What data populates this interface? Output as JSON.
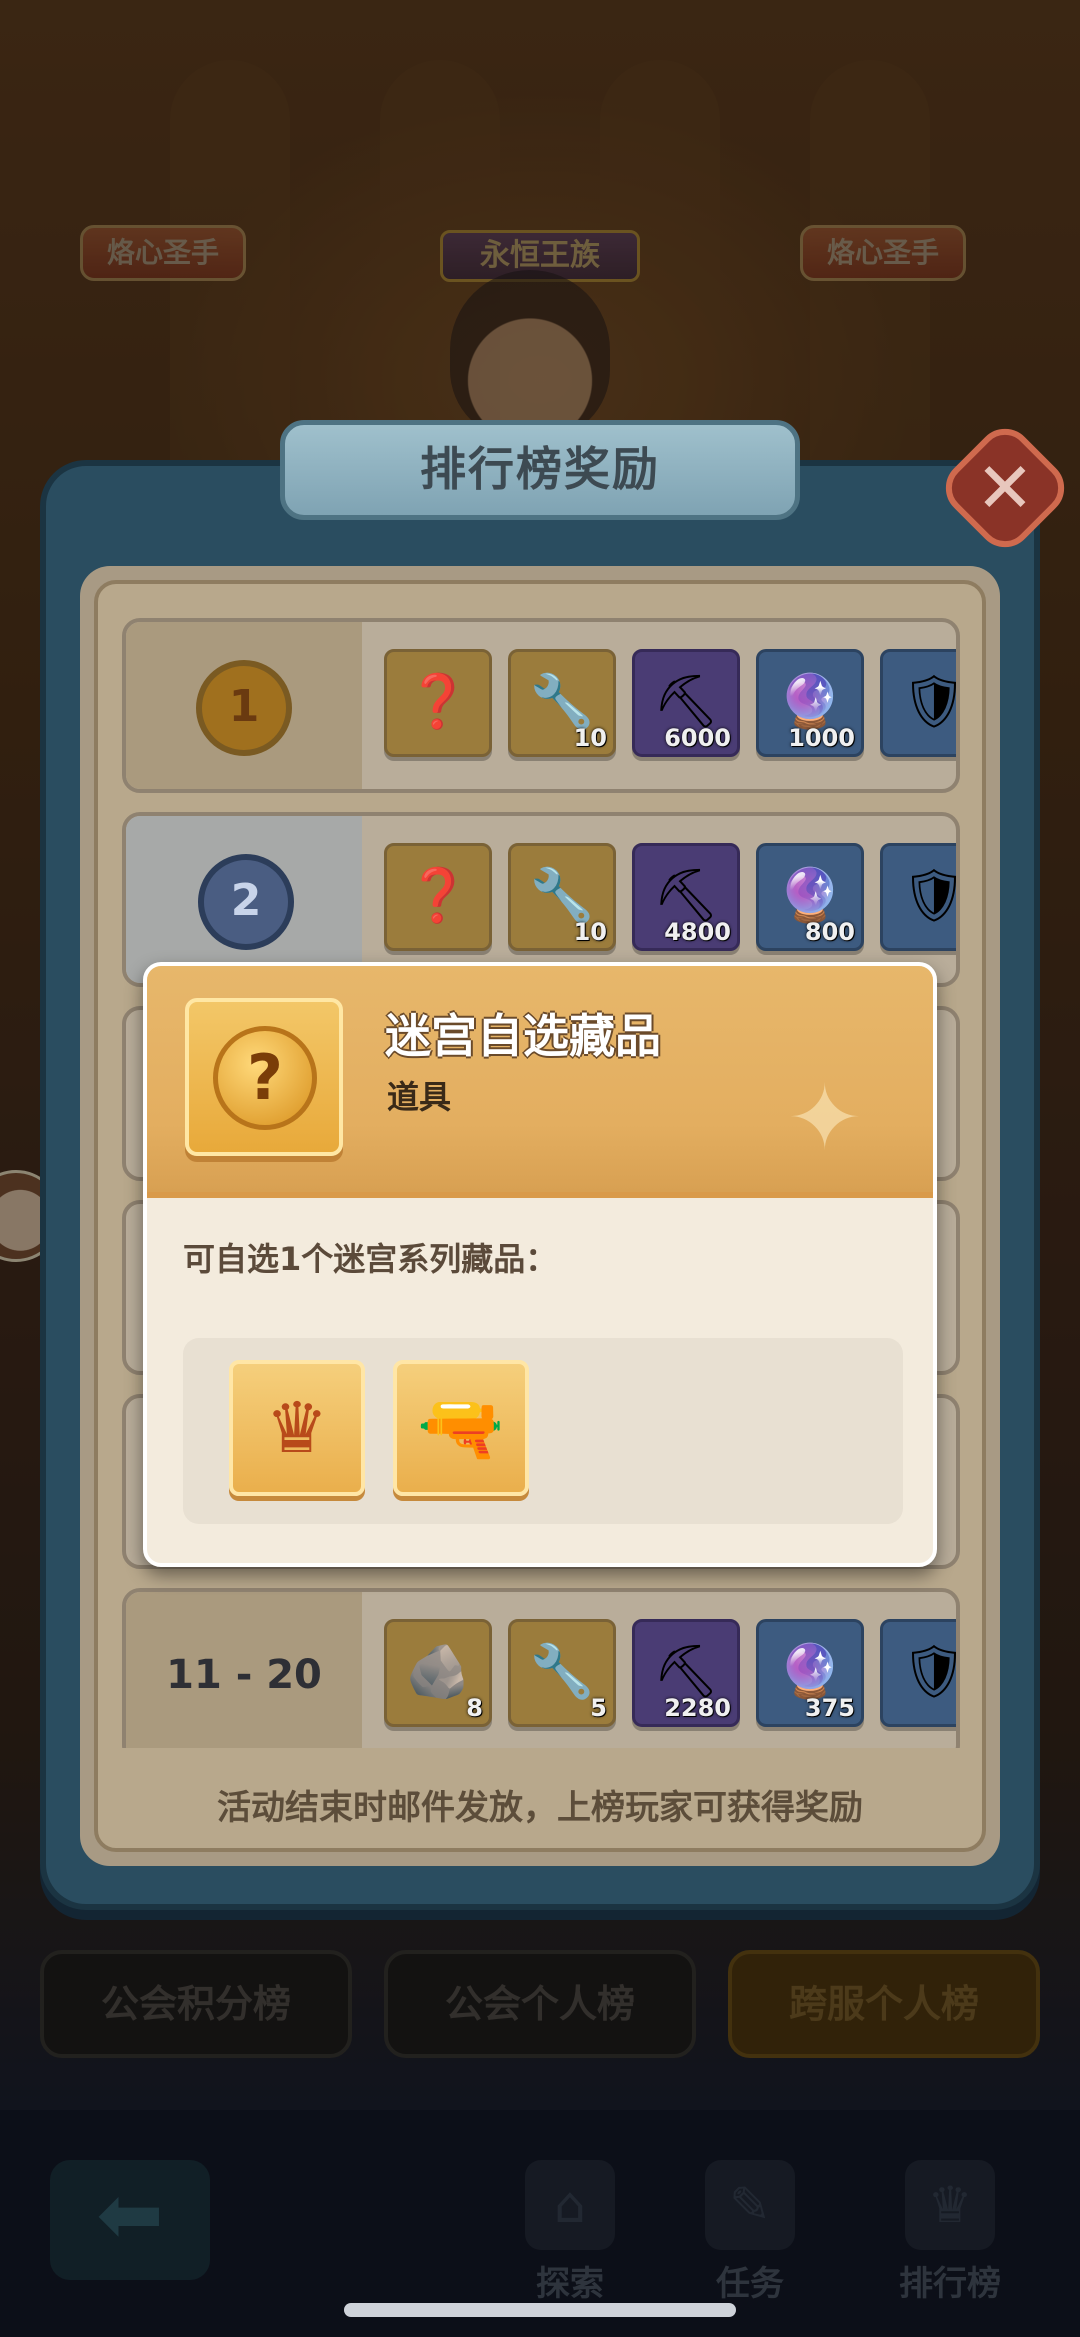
{
  "background": {
    "champion_badge_left": "烙心圣手",
    "champion_badge_right": "烙心圣手",
    "center_title_badge": "永恒王族"
  },
  "panel": {
    "title": "排行榜奖励",
    "close_icon": "close-icon",
    "footnote": "活动结束时邮件发放，上榜玩家可获得奖励"
  },
  "rows": [
    {
      "rank": "1",
      "items": [
        {
          "icon": "mystery-collectible-icon",
          "count": ""
        },
        {
          "icon": "chisel-icon",
          "count": "10"
        },
        {
          "icon": "shovel-icon",
          "count": "6000"
        },
        {
          "icon": "mystery-orb-icon",
          "count": "1000"
        },
        {
          "icon": "crest-badge-icon",
          "count": ""
        }
      ]
    },
    {
      "rank": "2",
      "items": [
        {
          "icon": "mystery-collectible-icon",
          "count": ""
        },
        {
          "icon": "chisel-icon",
          "count": "10"
        },
        {
          "icon": "shovel-icon",
          "count": "4800"
        },
        {
          "icon": "mystery-orb-icon",
          "count": "800"
        },
        {
          "icon": "crest-badge-icon",
          "count": ""
        }
      ]
    },
    {
      "rank": "11 - 20",
      "items": [
        {
          "icon": "ore-rock-icon",
          "count": "8"
        },
        {
          "icon": "chisel-icon",
          "count": "5"
        },
        {
          "icon": "shovel-icon",
          "count": "2280"
        },
        {
          "icon": "mystery-orb-icon",
          "count": "375"
        },
        {
          "icon": "crest-badge-icon",
          "count": ""
        }
      ]
    }
  ],
  "popup": {
    "title": "迷宫自选藏品",
    "type": "道具",
    "description": "可自选1个迷宫系列藏品：",
    "choices": [
      {
        "icon": "golden-crown-icon"
      },
      {
        "icon": "ray-gun-icon"
      }
    ]
  },
  "tabs": [
    {
      "label": "公会积分榜"
    },
    {
      "label": "公会个人榜"
    },
    {
      "label": "跨服个人榜"
    }
  ],
  "nav": [
    {
      "label": "探索",
      "icon": "explore-icon"
    },
    {
      "label": "任务",
      "icon": "task-icon"
    },
    {
      "label": "排行榜",
      "icon": "trophy-icon"
    }
  ]
}
